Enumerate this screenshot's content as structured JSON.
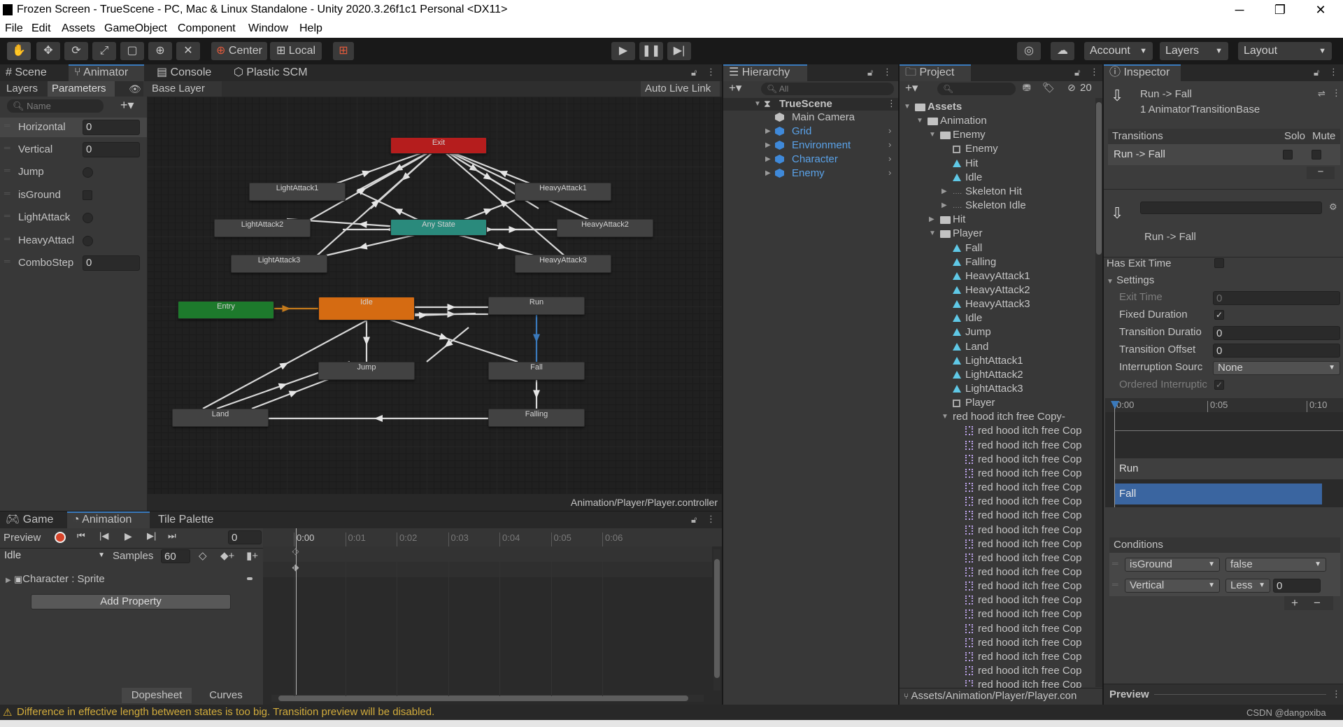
{
  "window": {
    "title": "Frozen Screen - TrueScene - PC, Mac & Linux Standalone - Unity 2020.3.26f1c1 Personal <DX11>",
    "min": "─",
    "max": "❐",
    "close": "✕"
  },
  "menu": [
    "File",
    "Edit",
    "Assets",
    "GameObject",
    "Component",
    "Window",
    "Help"
  ],
  "toolbar": {
    "center": "Center",
    "local": "Local",
    "account": "Account",
    "layers": "Layers",
    "layout": "Layout"
  },
  "animator_tabs": [
    "Scene",
    "Animator",
    "Console",
    "Plastic SCM"
  ],
  "animator": {
    "layers_tab": "Layers",
    "params_tab": "Parameters",
    "base_layer": "Base Layer",
    "auto_live": "Auto Live Link",
    "name_placeholder": "Name",
    "footer": "Animation/Player/Player.controller",
    "params": [
      {
        "name": "Horizontal",
        "value": "0"
      },
      {
        "name": "Vertical",
        "value": "0"
      },
      {
        "name": "Jump",
        "value": ""
      },
      {
        "name": "isGround",
        "value": ""
      },
      {
        "name": "LightAttack",
        "value": ""
      },
      {
        "name": "HeavyAttacl",
        "value": ""
      },
      {
        "name": "ComboStep",
        "value": "0"
      }
    ],
    "states": {
      "exit": "Exit",
      "la1": "LightAttack1",
      "ha1": "HeavyAttack1",
      "la2": "LightAttack2",
      "any": "Any State",
      "ha2": "HeavyAttack2",
      "la3": "LightAttack3",
      "ha3": "HeavyAttack3",
      "entry": "Entry",
      "idle": "Idle",
      "run": "Run",
      "jump": "Jump",
      "fall": "Fall",
      "land": "Land",
      "falling": "Falling"
    }
  },
  "hierarchy": {
    "title": "Hierarchy",
    "search": "All",
    "scene": "TrueScene",
    "items": [
      "Main Camera",
      "Grid",
      "Environment",
      "Character",
      "Enemy"
    ]
  },
  "project": {
    "title": "Project",
    "badge": "20",
    "footer": "Assets/Animation/Player/Player.con",
    "tree": [
      "Assets",
      "Animation",
      "Enemy",
      "Enemy",
      "Hit",
      "Idle",
      "Skeleton Hit",
      "Skeleton Idle",
      "Hit",
      "Player",
      "Fall",
      "Falling",
      "HeavyAttack1",
      "HeavyAttack2",
      "HeavyAttack3",
      "Idle",
      "Jump",
      "Land",
      "LightAttack1",
      "LightAttack2",
      "LightAttack3",
      "Player",
      "red hood itch free Copy-"
    ],
    "sprite_label": "red hood itch free Cop"
  },
  "inspector": {
    "title": "Inspector",
    "name": "Run -> Fall",
    "type": "1 AnimatorTransitionBase",
    "transitions": "Transitions",
    "solo": "Solo",
    "mute": "Mute",
    "row": "Run -> Fall",
    "name2": "Run -> Fall",
    "has_exit": "Has Exit Time",
    "settings": "Settings",
    "fields": [
      {
        "label": "Exit Time",
        "value": "0",
        "dim": true
      },
      {
        "label": "Fixed Duration",
        "value": "✓",
        "check": true
      },
      {
        "label": "Transition Duratio",
        "value": "0"
      },
      {
        "label": "Transition Offset",
        "value": "0"
      },
      {
        "label": "Interruption Sourc",
        "value": "None",
        "combo": true
      },
      {
        "label": "Ordered Interruptic",
        "value": "✓",
        "check": true,
        "dim": true
      }
    ],
    "timeline": [
      "0:00",
      "0:05",
      "0:10"
    ],
    "run": "Run",
    "fall": "Fall",
    "conditions": "Conditions",
    "conds": [
      {
        "param": "isGround",
        "op": "false",
        "val": ""
      },
      {
        "param": "Vertical",
        "op": "Less",
        "val": "0"
      }
    ],
    "preview": "Preview",
    "plus": "+",
    "minus": "−"
  },
  "anim_tabs": [
    "Game",
    "Animation",
    "Tile Palette"
  ],
  "anim": {
    "preview": "Preview",
    "frame": "0",
    "clip": "Idle",
    "samples_label": "Samples",
    "samples": "60",
    "property": "Character : Sprite",
    "add": "Add Property",
    "dopesheet": "Dopesheet",
    "curves": "Curves",
    "ticks": [
      "0:00",
      "0:01",
      "0:02",
      "0:03",
      "0:04",
      "0:05",
      "0:06"
    ]
  },
  "status": {
    "msg": "Difference in effective length between states is too big. Transition preview will be disabled.",
    "watermark": "CSDN @dangoxiba"
  },
  "colors": {
    "accent": "#3a79bb",
    "exit": "#b51d1d",
    "entry": "#1d7a2c",
    "idle": "#d56b12",
    "any": "#2a8a7c",
    "fall_bar": "#3a65a0"
  }
}
